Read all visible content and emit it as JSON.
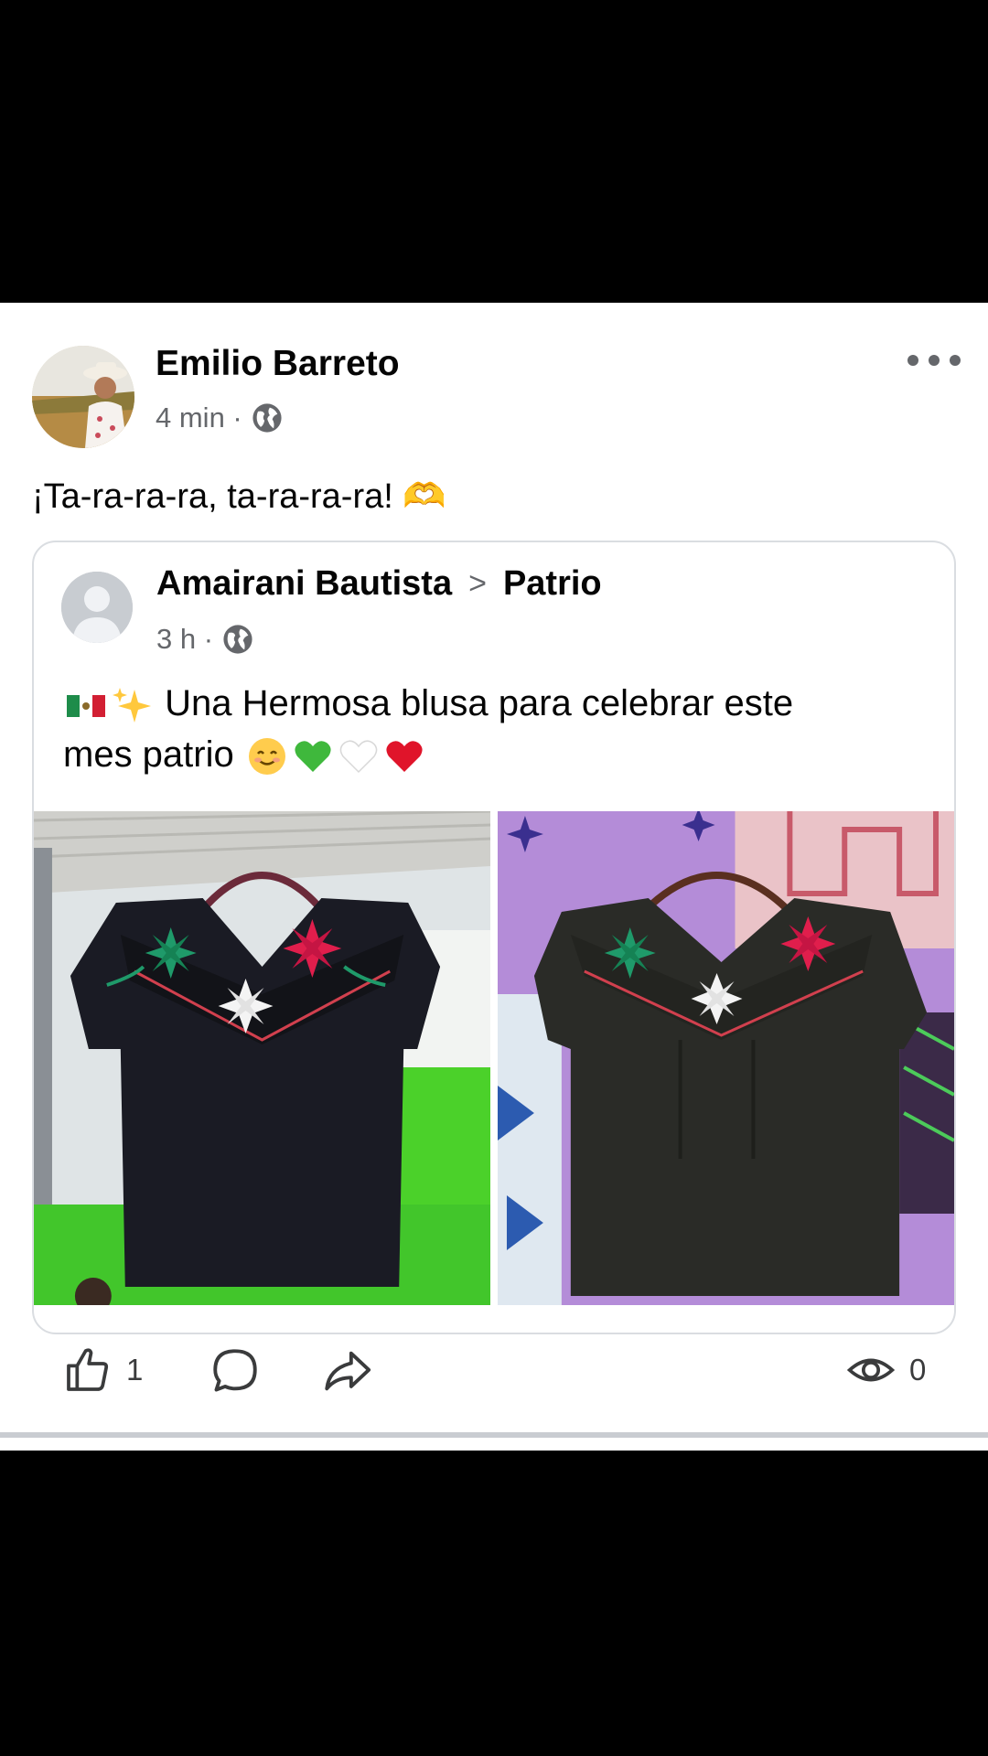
{
  "post": {
    "author": "Emilio Barreto",
    "time": "4 min ·",
    "text": "¡Ta-ra-ra-ra, ta-ra-ra-ra! 🫶",
    "reactions_count": "1",
    "views_count": "0"
  },
  "shared": {
    "author": "Amairani Bautista",
    "arrow": ">",
    "group": "Patrio",
    "time": "3 h ·",
    "text_line1": "Una Hermosa blusa para celebrar este",
    "text_line2": "mes patrio"
  },
  "icons": [
    "avatar-photo",
    "globe-icon",
    "more-icon",
    "mexico-flag-icon",
    "sparkles-icon",
    "smile-emoji",
    "green-heart-emoji",
    "white-heart-emoji",
    "red-heart-emoji",
    "like-icon",
    "comment-icon",
    "share-icon",
    "eye-icon"
  ],
  "colors": {
    "secondary_text": "#65676b",
    "border": "#dadde1",
    "divider": "#c9ccd1"
  }
}
